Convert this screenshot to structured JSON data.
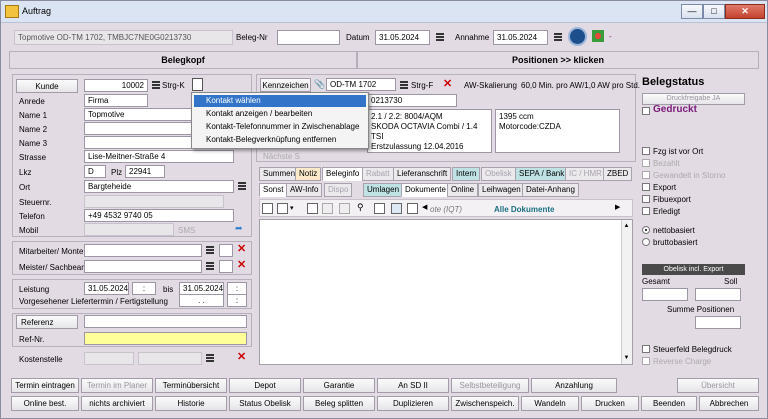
{
  "window": {
    "title": "Auftrag"
  },
  "header": {
    "vehicle": "Topmotive OD-TM 1702, TMBJC7NE0G0213730",
    "belegnr_label": "Beleg-Nr",
    "belegnr_value": "",
    "datum_label": "Datum",
    "datum_value": "31.05.2024",
    "annahme_label": "Annahme",
    "annahme_value": "31.05.2024",
    "dash": "-"
  },
  "section_tabs": {
    "belegkopf": "Belegkopf",
    "positionen": "Positionen >> klicken"
  },
  "customer": {
    "kunde_button": "Kunde",
    "kunde_value": "10002",
    "strgk": "Strg-K",
    "anrede_label": "Anrede",
    "anrede_value": "Firma",
    "name1_label": "Name 1",
    "name1_value": "Topmotive",
    "name2_label": "Name 2",
    "name3_label": "Name 3",
    "strasse_label": "Strasse",
    "strasse_value": "Lise-Meitner-Straße 4",
    "lkz_label": "Lkz",
    "lkz_value": "D",
    "plz_label": "Plz",
    "plz_value": "22941",
    "ort_label": "Ort",
    "ort_value": "Bargteheide",
    "steuernr_label": "Steuernr.",
    "telefon_label": "Telefon",
    "telefon_value": "+49 4532 9740 05",
    "mobil_label": "Mobil",
    "sms_label": "SMS"
  },
  "context_menu": {
    "items": [
      "Kontakt wählen",
      "Kontakt anzeigen / bearbeiten",
      "Kontakt-Telefonnummer in Zwischenablage",
      "Kontakt-Belegverknüpfung entfernen"
    ]
  },
  "staff": {
    "mitarbeiter_label": "Mitarbeiter/ Monteur",
    "meister_label": "Meister/ Sachbearb."
  },
  "period": {
    "leistung_label": "Leistung",
    "leistung_from": "31.05.2024",
    "bis_label": "bis",
    "leistung_to": "31.05.2024",
    "time_placeholder": ":",
    "liefertermin_label": "Vorgesehener Liefertermin / Fertigstellung",
    "liefertermin_value": ". ."
  },
  "reference": {
    "referenz_label": "Referenz",
    "refnr_label": "Ref-Nr.",
    "kostenstelle_label": "Kostenstelle"
  },
  "vehicle": {
    "kennzeichen_button": "Kennzeichen",
    "kennzeichen_value": "OD-TM 1702",
    "strgf": "Strg-F",
    "aw_skalierung": "AW-Skalierung",
    "aw_info": "60,0 Min. pro AW/1,0 AW pro Std.",
    "vin_partial": "0213730",
    "model_line1": "2.1 / 2.2: 8004/AQM",
    "model_line2": "SKODA OCTAVIA Combi / 1.4",
    "model_line3": "TSI",
    "erstzulassung": "Erstzulassung 12.04.2016",
    "ccm": "1395 ccm",
    "motorcode": "Motorcode:CZDA",
    "naechste": "Nächste S"
  },
  "tabs_row1": [
    "Summen",
    "Notiz",
    "Beleginfo",
    "Rabatt",
    "Lieferanschrift",
    "Intern",
    "Obelisk",
    "SEPA / Bank",
    "IC / HMR",
    "ZBED"
  ],
  "tabs_row2": [
    "Sonst",
    "AW-Info",
    "Dispo",
    "Umlagen",
    "Dokumente",
    "Online",
    "Leihwagen",
    "Datei-Anhang"
  ],
  "documents": {
    "filter_label": "ote (IQT)",
    "all_docs": "Alle Dokumente"
  },
  "status": {
    "title": "Belegstatus",
    "druckfreigabe": "Druckfreigabe JA",
    "gedruckt": "Gedruckt",
    "fzg_vor_ort": "Fzg ist vor Ort",
    "bezahlt": "Bezahlt",
    "gewandelt": "Gewandelt in Storno",
    "export": "Export",
    "fibuexport": "Fibuexport",
    "erledigt": "Erledigt",
    "nettobasiert": "nettobasiert",
    "bruttobasiert": "bruttobasiert",
    "obelisk_export": "Obelisk incl. Export",
    "gesamt": "Gesamt",
    "soll": "Soll",
    "summe_positionen": "Summe Positionen",
    "steuerfeld": "Steuerfeld Belegdruck",
    "reverse_charge": "Reverse Charge"
  },
  "footer_row1": [
    "Termin eintragen",
    "Termin im Planer",
    "Terminübersicht",
    "Depot",
    "Garantie",
    "An SD II",
    "Selbstbeteiligung",
    "Anzahlung",
    "Übersicht"
  ],
  "footer_row2": [
    "Online best.",
    "nichts archiviert",
    "Historie",
    "Status Obelisk",
    "Beleg splitten",
    "Duplizieren",
    "Zwischenspeich.",
    "Wandeln",
    "Drucken",
    "Beenden",
    "Abbrechen"
  ],
  "colors": {
    "background": "#e3dbe4",
    "accent_purple": "#7a1b7a",
    "tab_teal": "#bfe3e5",
    "menu_selected": "#3174c8",
    "delete_red": "#cc0000"
  }
}
